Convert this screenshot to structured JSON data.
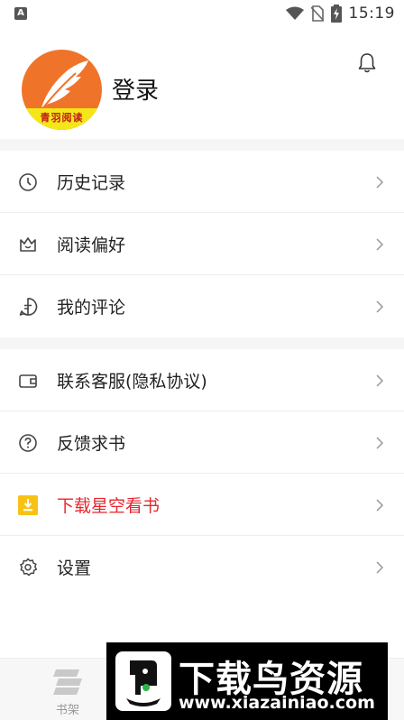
{
  "status_bar": {
    "time": "15:19",
    "app_icon_letter": "A",
    "icons": [
      "wifi-icon",
      "no-sim-icon",
      "battery-charging-icon"
    ]
  },
  "header": {
    "login_label": "登录",
    "avatar_text": "青羽阅读"
  },
  "menu": {
    "group1": [
      {
        "label": "历史记录",
        "icon": "clock-icon"
      },
      {
        "label": "阅读偏好",
        "icon": "crown-icon"
      },
      {
        "label": "我的评论",
        "icon": "comment-icon"
      }
    ],
    "group2": [
      {
        "label": "联系客服(隐私协议)",
        "icon": "wallet-icon"
      },
      {
        "label": "反馈求书",
        "icon": "question-icon"
      },
      {
        "label": "下载星空看书",
        "icon": "download-icon",
        "highlight_color": "#e8262d"
      },
      {
        "label": "设置",
        "icon": "gear-icon"
      }
    ]
  },
  "tabbar": {
    "shelf_label": "书架"
  },
  "watermark": {
    "title": "下载鸟资源",
    "url": "www.xiazainiao.com"
  },
  "colors": {
    "accent_red": "#e8262d",
    "download_yellow": "#f7c215",
    "avatar_orange": "#f0732a",
    "avatar_band": "#f5e619"
  }
}
